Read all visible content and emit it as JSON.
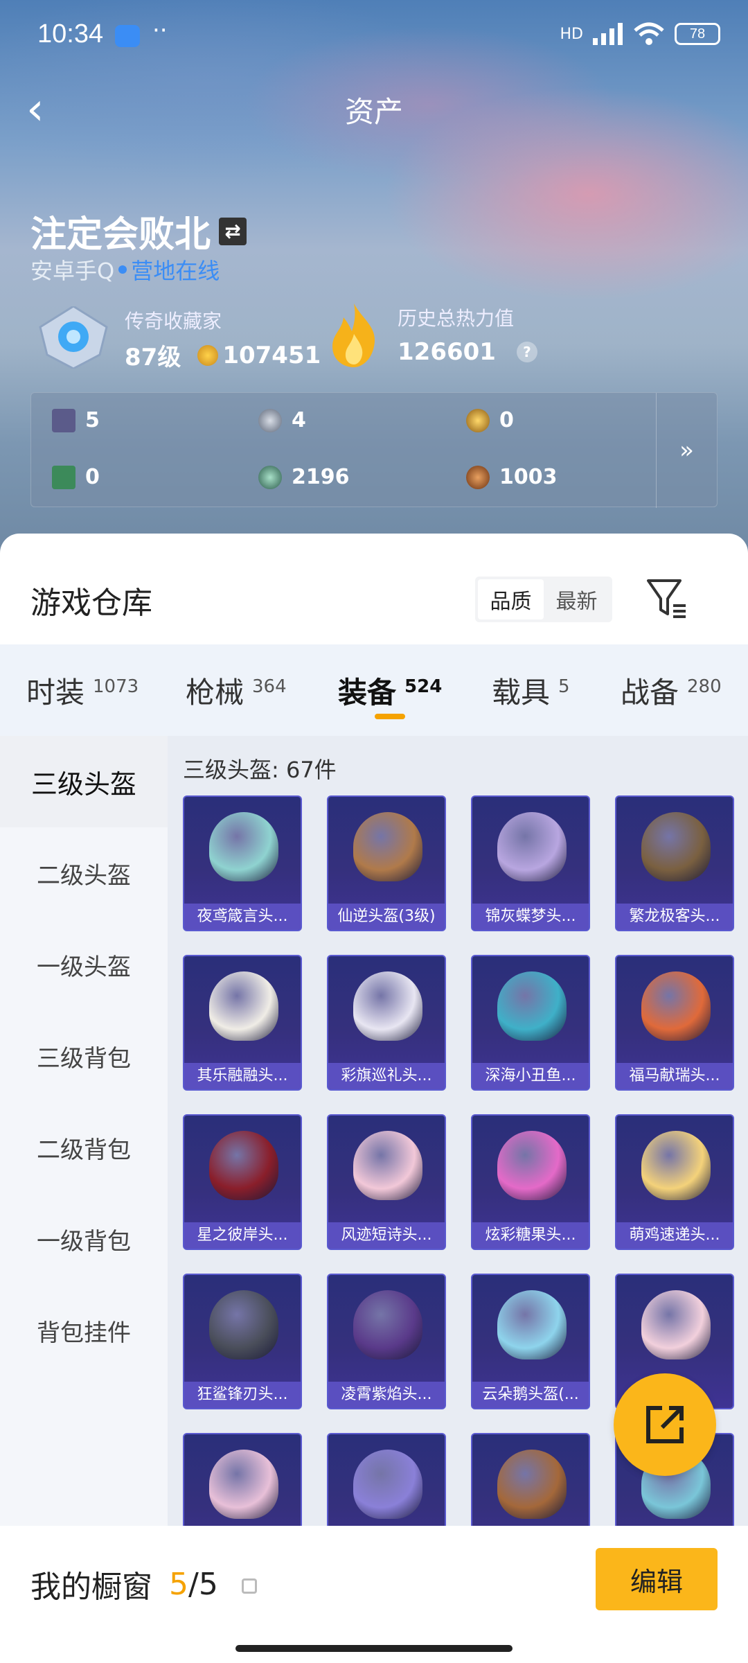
{
  "status_bar": {
    "time": "10:34",
    "more": "··",
    "network": "HD",
    "battery": "78"
  },
  "nav": {
    "title": "资产"
  },
  "profile": {
    "name": "注定会败北",
    "platform": "安卓手Q",
    "presence": "营地在线",
    "collector_title": "传奇收藏家",
    "level": "87级",
    "coins": "107451",
    "heat_title": "历史总热力值",
    "heat_value": "126601",
    "help": "?"
  },
  "currencies": [
    {
      "value": "5",
      "icon": "card-icon"
    },
    {
      "value": "4",
      "icon": "silver-token-icon"
    },
    {
      "value": "0",
      "icon": "gold-token-icon"
    },
    {
      "value": "0",
      "icon": "green-card-icon"
    },
    {
      "value": "2196",
      "icon": "teal-coin-icon"
    },
    {
      "value": "1003",
      "icon": "bronze-coin-icon"
    }
  ],
  "currency_more": "»",
  "warehouse": {
    "title": "游戏仓库",
    "sort": [
      "品质",
      "最新"
    ]
  },
  "tabs": [
    {
      "label": "时装",
      "count": "1073"
    },
    {
      "label": "枪械",
      "count": "364"
    },
    {
      "label": "装备",
      "count": "524"
    },
    {
      "label": "载具",
      "count": "5"
    },
    {
      "label": "战备",
      "count": "280"
    }
  ],
  "sidebar": [
    "三级头盔",
    "二级头盔",
    "一级头盔",
    "三级背包",
    "二级背包",
    "一级背包",
    "背包挂件"
  ],
  "content": {
    "count_label": "三级头盔: 67件"
  },
  "items": [
    {
      "name": "夜鸢箴言头...",
      "color": "#8fd3d0"
    },
    {
      "name": "仙逆头盔(3级)",
      "color": "#b07a4a"
    },
    {
      "name": "锦灰蝶梦头...",
      "color": "#b8a6e0"
    },
    {
      "name": "繁龙极客头...",
      "color": "#7a6040"
    },
    {
      "name": "其乐融融头...",
      "color": "#f0ede6"
    },
    {
      "name": "彩旗巡礼头...",
      "color": "#e8e6f2"
    },
    {
      "name": "深海小丑鱼...",
      "color": "#3fb0c8"
    },
    {
      "name": "福马献瑞头...",
      "color": "#e06a3a"
    },
    {
      "name": "星之彼岸头...",
      "color": "#8a1e2a"
    },
    {
      "name": "风迹短诗头...",
      "color": "#f2c8d8"
    },
    {
      "name": "炫彩糖果头...",
      "color": "#e46ac8"
    },
    {
      "name": "萌鸡速递头...",
      "color": "#f4d27a"
    },
    {
      "name": "狂鲨锋刃头...",
      "color": "#4a4e5a"
    },
    {
      "name": "凌霄紫焰头...",
      "color": "#5a3a8a"
    },
    {
      "name": "云朵鹅头盔(...",
      "color": "#8ed4ec"
    },
    {
      "name": "",
      "color": "#f2d0dc"
    },
    {
      "name": "",
      "color": "#e8c0d8"
    },
    {
      "name": "",
      "color": "#8a80d8"
    },
    {
      "name": "",
      "color": "#a4683a"
    },
    {
      "name": "",
      "color": "#7ac6d8"
    }
  ],
  "showcase": {
    "label": "我的橱窗",
    "current": "5",
    "separator": "/",
    "total": "5",
    "edit": "编辑"
  }
}
